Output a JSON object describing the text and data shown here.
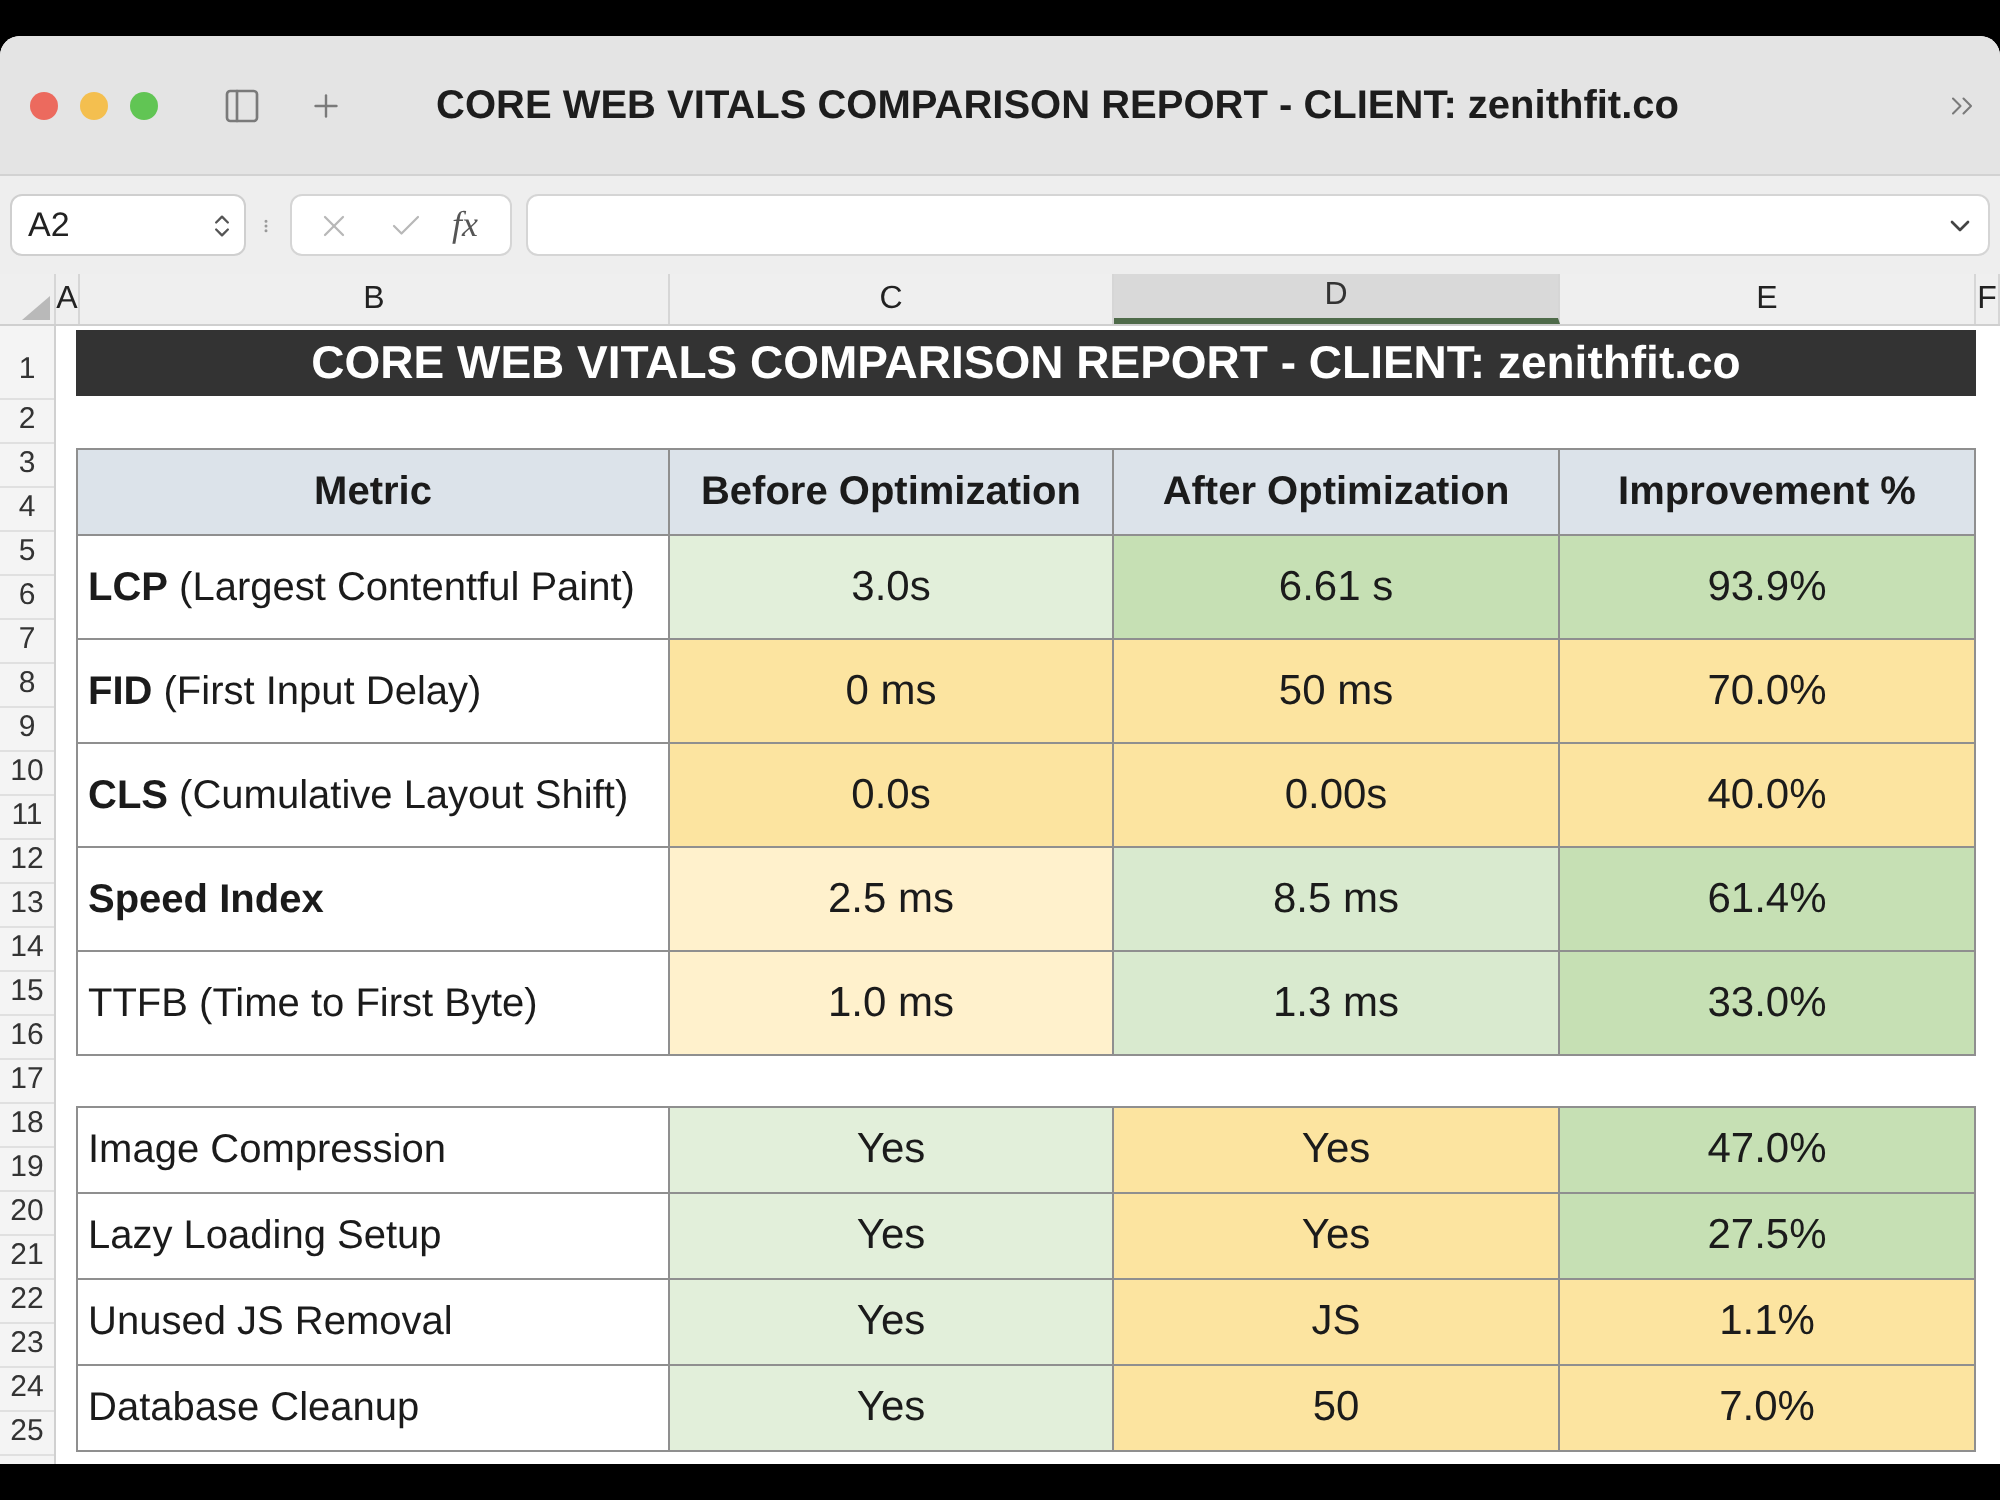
{
  "window": {
    "title": "CORE WEB VITALS COMPARISON REPORT - CLIENT: zenithfit.co"
  },
  "formula_bar": {
    "name_box": "A2",
    "function_icon": "fx"
  },
  "column_headers": [
    {
      "label": "A",
      "selected": false
    },
    {
      "label": "B",
      "selected": false
    },
    {
      "label": "C",
      "selected": false
    },
    {
      "label": "D",
      "selected": true
    },
    {
      "label": "E",
      "selected": false
    },
    {
      "label": "F",
      "selected": false
    }
  ],
  "row_headers": [
    "1",
    "2",
    "3",
    "4",
    "5",
    "6",
    "7",
    "8",
    "9",
    "10",
    "11",
    "12",
    "13",
    "14",
    "15",
    "16",
    "17",
    "18",
    "19",
    "20",
    "21",
    "22",
    "23",
    "24",
    "25"
  ],
  "sheet_title": "CORE WEB VITALS COMPARISON REPORT - CLIENT: zenithfit.co",
  "metrics_table": {
    "columns": [
      "Metric",
      "Before Optimization",
      "After Optimization",
      "Improvement %"
    ],
    "rows": [
      {
        "cells": [
          {
            "text": "**LCP** (Largest Contentful Paint)",
            "bold": false
          },
          {
            "text": "3.0s",
            "color": "#e2efda"
          },
          {
            "text": "6.61 s",
            "color": "#c6e0b4"
          },
          {
            "text": "93.9%",
            "color": "#c6e0b4"
          }
        ]
      },
      {
        "cells": [
          {
            "text": "**FID** (First Input Delay)",
            "bold": false
          },
          {
            "text": "0 ms",
            "color": "#fce4a0"
          },
          {
            "text": "50 ms",
            "color": "#fce4a0"
          },
          {
            "text": "70.0%",
            "color": "#fce4a0"
          }
        ]
      },
      {
        "cells": [
          {
            "text": "**CLS** (Cumulative Layout Shift)",
            "bold": false
          },
          {
            "text": "0.0s",
            "color": "#fce4a0"
          },
          {
            "text": "0.00s",
            "color": "#fce4a0"
          },
          {
            "text": "40.0%",
            "color": "#fce4a0"
          }
        ]
      },
      {
        "cells": [
          {
            "text": "Speed Index",
            "bold": true
          },
          {
            "text": "2.5 ms",
            "color": "#fff1cc"
          },
          {
            "text": "8.5 ms",
            "color": "#d9eacf"
          },
          {
            "text": "61.4%",
            "color": "#c6e0b4"
          }
        ]
      },
      {
        "cells": [
          {
            "text": "TTFB (Time to First Byte)",
            "bold": false
          },
          {
            "text": "1.0 ms",
            "color": "#fff1cc"
          },
          {
            "text": "1.3 ms",
            "color": "#d9eacf"
          },
          {
            "text": "33.0%",
            "color": "#c6e0b4"
          }
        ]
      }
    ]
  },
  "optimizations_table": {
    "rows": [
      {
        "cells": [
          {
            "text": "Image Compression"
          },
          {
            "text": "Yes",
            "color": "#e2efda"
          },
          {
            "text": "Yes",
            "color": "#fce4a0"
          },
          {
            "text": "47.0%",
            "color": "#c6e0b4"
          }
        ]
      },
      {
        "cells": [
          {
            "text": "Lazy Loading Setup"
          },
          {
            "text": "Yes",
            "color": "#e2efda"
          },
          {
            "text": "Yes",
            "color": "#fce4a0"
          },
          {
            "text": "27.5%",
            "color": "#c6e0b4"
          }
        ]
      },
      {
        "cells": [
          {
            "text": "Unused JS Removal"
          },
          {
            "text": "Yes",
            "color": "#e2efda"
          },
          {
            "text": "JS",
            "color": "#fce4a0"
          },
          {
            "text": "1.1%",
            "color": "#fce4a0"
          }
        ]
      },
      {
        "cells": [
          {
            "text": "Database Cleanup"
          },
          {
            "text": "Yes",
            "color": "#e2efda"
          },
          {
            "text": "50",
            "color": "#fce4a0"
          },
          {
            "text": "7.0%",
            "color": "#fce4a0"
          }
        ]
      }
    ]
  }
}
